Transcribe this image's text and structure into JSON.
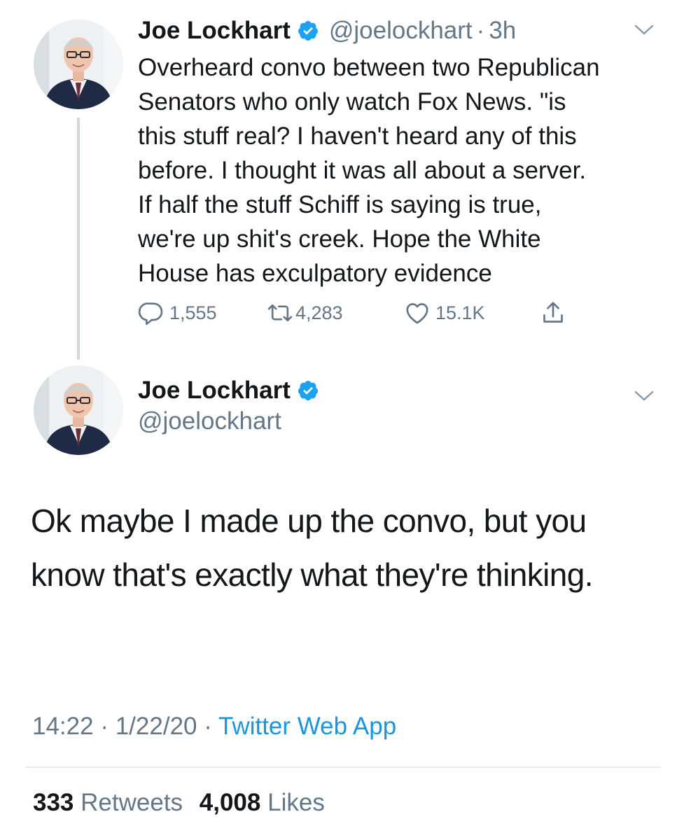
{
  "tweet1": {
    "author_name": "Joe Lockhart",
    "handle": "@joelockhart",
    "separator": "·",
    "time": "3h",
    "text": "Overheard convo between two Republican\nSenators who only watch Fox News. \"is\nthis stuff real? I haven't heard any of this\nbefore. I thought it was all about a server.\nIf half the stuff Schiff is saying is true,\nwe're up shit's creek. Hope the White\nHouse has exculpatory evidence",
    "replies": "1,555",
    "retweets": "4,283",
    "likes": "15.1K",
    "icons": [
      "reply-icon",
      "retweet-icon",
      "like-icon",
      "share-icon",
      "verified-icon",
      "chevron-down-icon"
    ]
  },
  "tweet2": {
    "author_name": "Joe Lockhart",
    "handle": "@joelockhart",
    "text": "Ok maybe I made up the convo, but you know that's exactly what they're thinking.",
    "timestamp_time": "14:22",
    "separator": "·",
    "timestamp_date": "1/22/20",
    "source": "Twitter Web App",
    "retweet_count": "333",
    "retweet_label": "Retweets",
    "like_count": "4,008",
    "like_label": "Likes"
  },
  "colors": {
    "text": "#14171a",
    "secondary": "#657786",
    "accent": "#1b95e0",
    "verified": "#1da1f2",
    "thread_line": "#cfd8de"
  }
}
